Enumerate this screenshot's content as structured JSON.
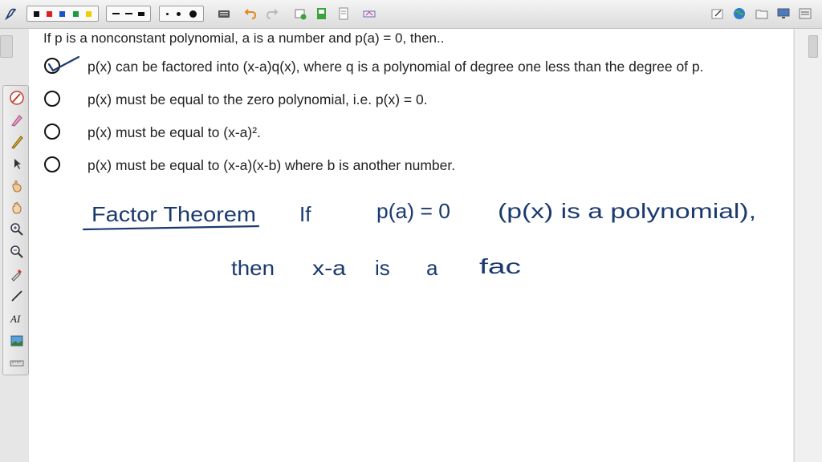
{
  "question": {
    "stem": "If p is a nonconstant polynomial, a is a number and p(a) = 0, then..",
    "options": [
      {
        "text": "p(x) can be factored into (x-a)q(x), where q is a polynomial of degree one less than the degree of p.",
        "marked": true
      },
      {
        "text": "p(x) must be equal to the zero polynomial, i.e. p(x) = 0.",
        "marked": false
      },
      {
        "text": "p(x) must be equal to (x-a)².",
        "marked": false
      },
      {
        "text": "p(x) must be equal to (x-a)(x-b) where b is another number.",
        "marked": false
      }
    ]
  },
  "handwriting": {
    "heading": "Factor Theorem",
    "if_word": "If",
    "condition": "p(a) = 0",
    "remark": "(p(x) is a polynomial),",
    "line2": [
      "then",
      "x-a",
      "is",
      "a",
      "fac"
    ]
  },
  "toolbar": {
    "left_icons": [
      "pen-logo-icon",
      "color-palette",
      "line-style",
      "line-width",
      "keyboard-icon",
      "undo-icon",
      "redo-icon",
      "new-page-icon",
      "save-icon",
      "pages-icon",
      "eraser-icon"
    ],
    "right_icons": [
      "edit-icon",
      "globe-icon",
      "folder-icon",
      "monitor-icon",
      "menu-icon"
    ],
    "palette_colors": [
      "#111111",
      "#e0201c",
      "#1c50c8",
      "#1c9c3c",
      "#f0d000"
    ]
  },
  "tools": [
    "pen-icon",
    "highlighter-icon",
    "marker-icon",
    "pointer-icon",
    "hand-icon",
    "pan-icon",
    "zoom-in-icon",
    "zoom-out-icon",
    "eyedropper-icon",
    "line-tool-icon",
    "text-tool-icon",
    "image-icon",
    "ruler-icon"
  ],
  "accent_ink": "#1a3a6e"
}
